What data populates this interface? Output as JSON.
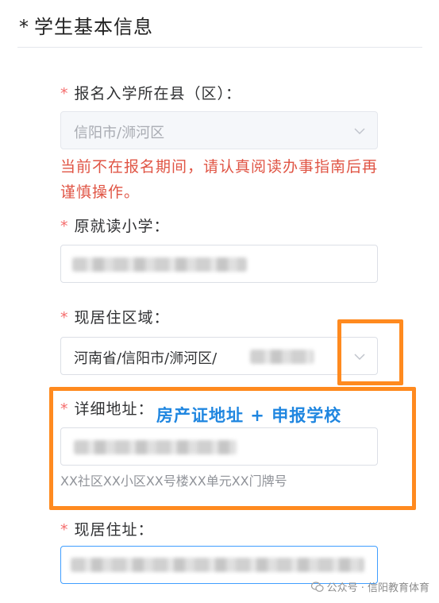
{
  "section": {
    "asterisk": "*",
    "title": "学生基本信息"
  },
  "required_mark": "*",
  "fields": {
    "county": {
      "label": "报名入学所在县（区）：",
      "value": "信阳市/浉河区",
      "warning": "当前不在报名期间，请认真阅读办事指南后再谨慎操作。"
    },
    "primary_school": {
      "label": "原就读小学："
    },
    "residence_area": {
      "label": "现居住区域：",
      "value": "河南省/信阳市/浉河区/"
    },
    "detail_address": {
      "label": "详细地址：",
      "hint": "XX社区XX小区XX号楼XX单元XX门牌号"
    },
    "current_address": {
      "label": "现居住址："
    }
  },
  "annotation": "房产证地址 + 申报学校",
  "watermark": "公众号 · 信阳教育体育",
  "colors": {
    "required": "#f56c6c",
    "warning": "#e05545",
    "annotation_box": "#ff8a1f",
    "annotation_text": "#1f86e0",
    "focus": "#409eff"
  }
}
